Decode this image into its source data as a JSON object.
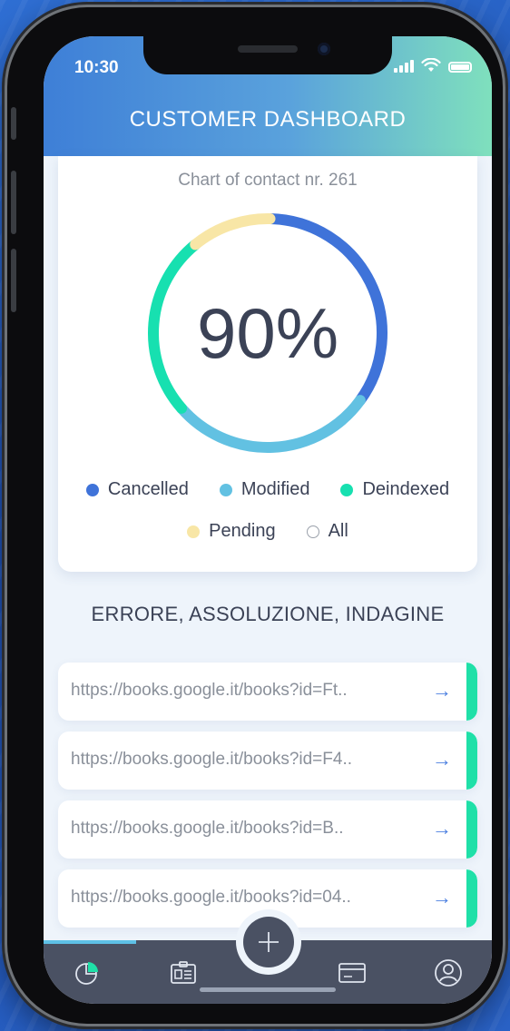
{
  "status_bar": {
    "time": "10:30"
  },
  "header": {
    "title": "CUSTOMER DASHBOARD"
  },
  "chart_card": {
    "subtitle": "Chart of contact nr. 261",
    "center_value": "90%",
    "legend": [
      {
        "label": "Cancelled",
        "color": "#3f73d9"
      },
      {
        "label": "Modified",
        "color": "#62c1e2"
      },
      {
        "label": "Deindexed",
        "color": "#17e0b0"
      },
      {
        "label": "Pending",
        "color": "#f8e6a6"
      },
      {
        "label": "All",
        "color": "#ffffff"
      }
    ]
  },
  "chart_data": {
    "type": "pie",
    "title": "Chart of contact nr. 261",
    "center_label": "90%",
    "series": [
      {
        "name": "Cancelled",
        "value": 34,
        "color": "#3f73d9"
      },
      {
        "name": "Modified",
        "value": 28,
        "color": "#62c1e2"
      },
      {
        "name": "Deindexed",
        "value": 25,
        "color": "#17e0b0"
      },
      {
        "name": "Pending",
        "value": 11,
        "color": "#f8e6a6"
      }
    ]
  },
  "section": {
    "title": "ERRORE, ASSOLUZIONE, INDAGINE"
  },
  "links": [
    {
      "url": "https://books.google.it/books?id=Ft.."
    },
    {
      "url": "https://books.google.it/books?id=F4.."
    },
    {
      "url": "https://books.google.it/books?id=B.."
    },
    {
      "url": "https://books.google.it/books?id=04.."
    }
  ],
  "tabbar": {
    "icons": [
      "pie-chart-icon",
      "id-card-icon",
      "plus-icon",
      "card-icon",
      "user-icon"
    ],
    "accent_color": "#5ec0e6",
    "link_accent_color": "#1fe0a8"
  }
}
